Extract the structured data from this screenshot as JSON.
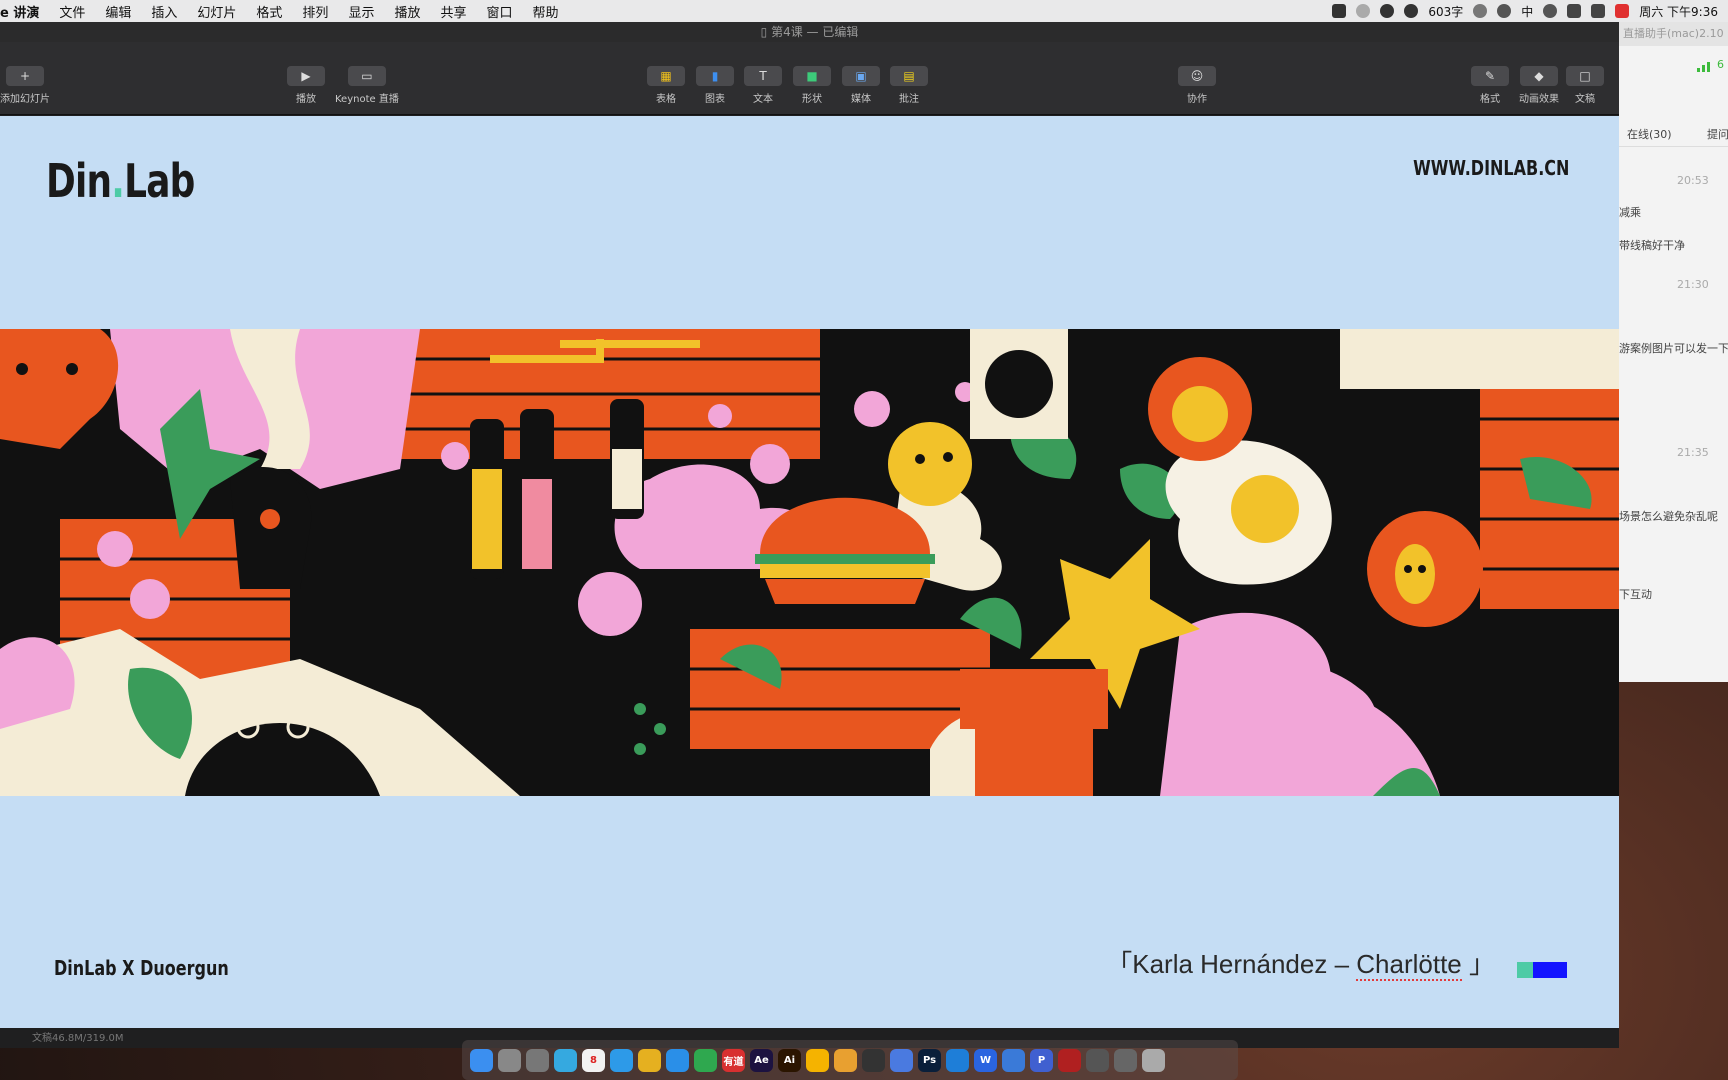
{
  "menubar": {
    "app": "e 讲演",
    "items": [
      "文件",
      "编辑",
      "插入",
      "幻灯片",
      "格式",
      "排列",
      "显示",
      "播放",
      "共享",
      "窗口",
      "帮助"
    ],
    "word_count": "603字",
    "ime": "中",
    "clock": "周六 下午9:36"
  },
  "window": {
    "title": "第4课 — 已编辑"
  },
  "toolbar": {
    "left": [
      {
        "icon": "plus-icon",
        "glyph": "+",
        "label": "添加幻灯片"
      },
      {
        "icon": "play-icon",
        "glyph": "▶",
        "label": "播放"
      },
      {
        "icon": "keynote-live-icon",
        "glyph": "▭",
        "label": "Keynote 直播"
      }
    ],
    "center": [
      {
        "icon": "table-icon",
        "glyph": "▦",
        "label": "表格"
      },
      {
        "icon": "chart-icon",
        "glyph": "▮",
        "label": "图表"
      },
      {
        "icon": "text-icon",
        "glyph": "T",
        "label": "文本"
      },
      {
        "icon": "shape-icon",
        "glyph": "■",
        "label": "形状"
      },
      {
        "icon": "media-icon",
        "glyph": "▣",
        "label": "媒体"
      },
      {
        "icon": "comment-icon",
        "glyph": "▤",
        "label": "批注"
      }
    ],
    "collab": {
      "icon": "collaborate-icon",
      "glyph": "☺",
      "label": "协作"
    },
    "right": [
      {
        "icon": "format-icon",
        "glyph": "✎",
        "label": "格式"
      },
      {
        "icon": "animate-icon",
        "glyph": "◆",
        "label": "动画效果"
      },
      {
        "icon": "document-icon",
        "glyph": "□",
        "label": "文稿"
      }
    ]
  },
  "slide": {
    "logo_left": "Din",
    "logo_dot": ".",
    "logo_right": "Lab",
    "url": "WWW.DINLAB.CN",
    "collab_text": "DinLab X Duoergun",
    "credit_open": "「Karla Hernández – ",
    "credit_name": "Charlötte",
    "credit_close": " 」",
    "swatch_colors": [
      "#4ecba6",
      "#1414ff"
    ]
  },
  "statusbar": {
    "text": "文稿46.8M/319.0M"
  },
  "chat": {
    "title": "直播助手(mac)2.10",
    "signal_suffix": "6",
    "tab_online": "在线(30)",
    "tab_question": "提问",
    "times": [
      "20:53",
      "21:30",
      "21:35"
    ],
    "messages": [
      "减乘",
      "带线稿好干净",
      "游案例图片可以发一下",
      "场景怎么避免杂乱呢",
      "下互动"
    ]
  },
  "dock": {
    "apps": [
      {
        "name": "finder-icon",
        "color": "#3b8ff0",
        "text": ""
      },
      {
        "name": "launchpad-icon",
        "color": "#888",
        "text": ""
      },
      {
        "name": "preferences-icon",
        "color": "#777",
        "text": ""
      },
      {
        "name": "telegram-icon",
        "color": "#35a9e0",
        "text": ""
      },
      {
        "name": "calendar-icon",
        "color": "#f2f2f2",
        "text": "8"
      },
      {
        "name": "safari-icon",
        "color": "#2d9ae8",
        "text": ""
      },
      {
        "name": "chrome-icon",
        "color": "#e5b020",
        "text": ""
      },
      {
        "name": "qq-icon",
        "color": "#2a8fe8",
        "text": ""
      },
      {
        "name": "evernote-icon",
        "color": "#2fa84f",
        "text": ""
      },
      {
        "name": "youdao-icon",
        "color": "#d83030",
        "text": "有道"
      },
      {
        "name": "after-effects-icon",
        "color": "#1c1240",
        "text": "Ae"
      },
      {
        "name": "illustrator-icon",
        "color": "#2b1500",
        "text": "Ai"
      },
      {
        "name": "sketch-icon",
        "color": "#f5b300",
        "text": ""
      },
      {
        "name": "folder-icon",
        "color": "#e8a030",
        "text": ""
      },
      {
        "name": "davinci-icon",
        "color": "#333",
        "text": ""
      },
      {
        "name": "cloud-icon",
        "color": "#4a7ae0",
        "text": ""
      },
      {
        "name": "photoshop-icon",
        "color": "#0a1f3a",
        "text": "Ps"
      },
      {
        "name": "browser-icon",
        "color": "#1e7ed8",
        "text": ""
      },
      {
        "name": "w-app-icon",
        "color": "#2a64e0",
        "text": "W"
      },
      {
        "name": "keynote-icon",
        "color": "#3a7ad8",
        "text": ""
      },
      {
        "name": "p-app-icon",
        "color": "#4060d0",
        "text": "P"
      },
      {
        "name": "screen-record-icon",
        "color": "#b02020",
        "text": ""
      },
      {
        "name": "downloads-icon",
        "color": "#555",
        "text": ""
      },
      {
        "name": "image-stack-icon",
        "color": "#666",
        "text": ""
      },
      {
        "name": "trash-icon",
        "color": "#aaa",
        "text": ""
      }
    ]
  }
}
